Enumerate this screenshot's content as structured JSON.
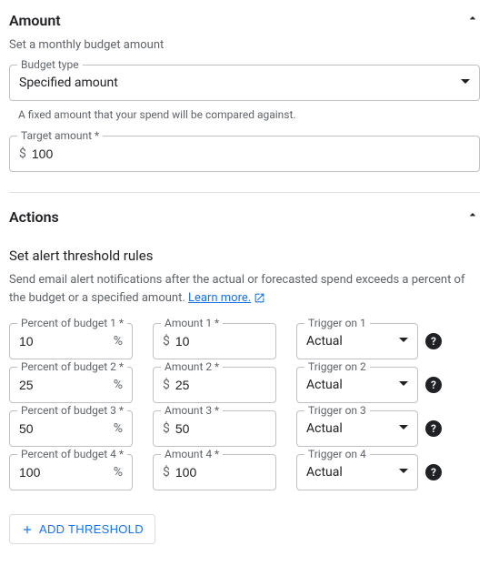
{
  "amount": {
    "title": "Amount",
    "subtitle": "Set a monthly budget amount",
    "budget_type": {
      "label": "Budget type",
      "value": "Specified amount",
      "helper": "A fixed amount that your spend will be compared against."
    },
    "target": {
      "label": "Target amount *",
      "currency": "$",
      "value": "100"
    }
  },
  "actions": {
    "title": "Actions",
    "rules_title": "Set alert threshold rules",
    "rules_desc": "Send email alert notifications after the actual or forecasted spend exceeds a percent of the budget or a specified amount. ",
    "learn_more": "Learn more.",
    "thresholds": [
      {
        "percent_label": "Percent of budget 1 *",
        "percent": "10",
        "amount_label": "Amount 1 *",
        "amount": "10",
        "trigger_label": "Trigger on 1",
        "trigger": "Actual"
      },
      {
        "percent_label": "Percent of budget 2 *",
        "percent": "25",
        "amount_label": "Amount 2 *",
        "amount": "25",
        "trigger_label": "Trigger on 2",
        "trigger": "Actual"
      },
      {
        "percent_label": "Percent of budget 3 *",
        "percent": "50",
        "amount_label": "Amount 3 *",
        "amount": "50",
        "trigger_label": "Trigger on 3",
        "trigger": "Actual"
      },
      {
        "percent_label": "Percent of budget 4 *",
        "percent": "100",
        "amount_label": "Amount 4 *",
        "amount": "100",
        "trigger_label": "Trigger on 4",
        "trigger": "Actual"
      }
    ],
    "add_label": "ADD THRESHOLD",
    "currency": "$",
    "percent_symbol": "%"
  }
}
